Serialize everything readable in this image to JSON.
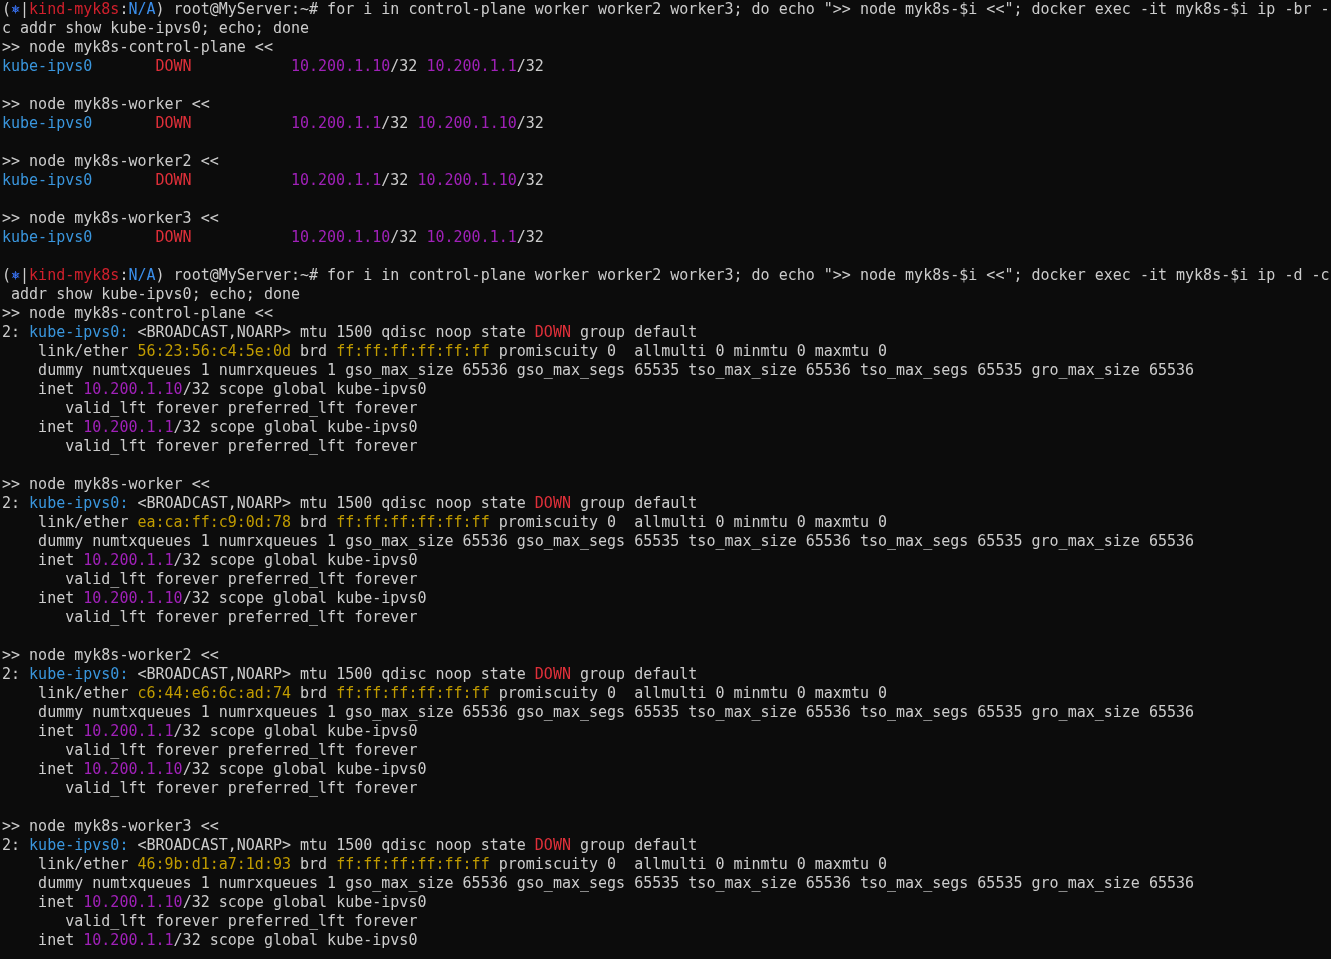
{
  "terminal": {
    "lines": [
      {
        "kind": "text",
        "segments": [
          {
            "kind": "plain",
            "text": "("
          },
          {
            "kind": "icon",
            "text": "⎈"
          },
          {
            "kind": "plain",
            "text": "|"
          },
          {
            "kind": "context",
            "text": "kind-myk8s"
          },
          {
            "kind": "plain",
            "text": ":"
          },
          {
            "kind": "namespace",
            "text": "N/A"
          },
          {
            "kind": "plain",
            "text": ") root@MyServer:~# for i in control-plane worker worker2 worker3; do echo \">> node myk8s-$i <<\"; docker exec -it myk8s-$i ip -br -"
          }
        ]
      },
      {
        "kind": "text",
        "segments": [
          {
            "kind": "plain",
            "text": "c addr show kube-ipvs0; echo; done"
          }
        ]
      },
      {
        "kind": "text",
        "segments": [
          {
            "kind": "plain",
            "text": ">> node myk8s-control-plane <<"
          }
        ]
      },
      {
        "kind": "brief",
        "iface": "kube-ipvs0",
        "state": "DOWN",
        "addresses": [
          {
            "ip": "10.200.1.10",
            "prefix": "/32"
          },
          {
            "ip": "10.200.1.1",
            "prefix": "/32"
          }
        ]
      },
      {
        "kind": "blank"
      },
      {
        "kind": "text",
        "segments": [
          {
            "kind": "plain",
            "text": ">> node myk8s-worker <<"
          }
        ]
      },
      {
        "kind": "brief",
        "iface": "kube-ipvs0",
        "state": "DOWN",
        "addresses": [
          {
            "ip": "10.200.1.1",
            "prefix": "/32"
          },
          {
            "ip": "10.200.1.10",
            "prefix": "/32"
          }
        ]
      },
      {
        "kind": "blank"
      },
      {
        "kind": "text",
        "segments": [
          {
            "kind": "plain",
            "text": ">> node myk8s-worker2 <<"
          }
        ]
      },
      {
        "kind": "brief",
        "iface": "kube-ipvs0",
        "state": "DOWN",
        "addresses": [
          {
            "ip": "10.200.1.1",
            "prefix": "/32"
          },
          {
            "ip": "10.200.1.10",
            "prefix": "/32"
          }
        ]
      },
      {
        "kind": "blank"
      },
      {
        "kind": "text",
        "segments": [
          {
            "kind": "plain",
            "text": ">> node myk8s-worker3 <<"
          }
        ]
      },
      {
        "kind": "brief",
        "iface": "kube-ipvs0",
        "state": "DOWN",
        "addresses": [
          {
            "ip": "10.200.1.10",
            "prefix": "/32"
          },
          {
            "ip": "10.200.1.1",
            "prefix": "/32"
          }
        ]
      },
      {
        "kind": "blank"
      },
      {
        "kind": "text",
        "segments": [
          {
            "kind": "plain",
            "text": "("
          },
          {
            "kind": "icon",
            "text": "⎈"
          },
          {
            "kind": "plain",
            "text": "|"
          },
          {
            "kind": "context",
            "text": "kind-myk8s"
          },
          {
            "kind": "plain",
            "text": ":"
          },
          {
            "kind": "namespace",
            "text": "N/A"
          },
          {
            "kind": "plain",
            "text": ") root@MyServer:~# for i in control-plane worker worker2 worker3; do echo \">> node myk8s-$i <<\"; docker exec -it myk8s-$i ip -d -c"
          }
        ]
      },
      {
        "kind": "text",
        "segments": [
          {
            "kind": "plain",
            "text": " addr show kube-ipvs0; echo; done"
          }
        ]
      },
      {
        "kind": "text",
        "segments": [
          {
            "kind": "plain",
            "text": ">> node myk8s-control-plane <<"
          }
        ]
      },
      {
        "kind": "text",
        "segments": [
          {
            "kind": "plain",
            "text": "2: "
          },
          {
            "kind": "iface",
            "text": "kube-ipvs0:"
          },
          {
            "kind": "plain",
            "text": " <BROADCAST,NOARP> mtu 1500 qdisc noop state "
          },
          {
            "kind": "state",
            "text": "DOWN"
          },
          {
            "kind": "plain",
            "text": " group default"
          }
        ]
      },
      {
        "kind": "text",
        "segments": [
          {
            "kind": "plain",
            "text": "    link/ether "
          },
          {
            "kind": "mac",
            "text": "56:23:56:c4:5e:0d"
          },
          {
            "kind": "plain",
            "text": " brd "
          },
          {
            "kind": "mac",
            "text": "ff:ff:ff:ff:ff:ff"
          },
          {
            "kind": "plain",
            "text": " promiscuity 0  allmulti 0 minmtu 0 maxmtu 0"
          }
        ]
      },
      {
        "kind": "text",
        "segments": [
          {
            "kind": "plain",
            "text": "    dummy numtxqueues 1 numrxqueues 1 gso_max_size 65536 gso_max_segs 65535 tso_max_size 65536 tso_max_segs 65535 gro_max_size 65536"
          }
        ]
      },
      {
        "kind": "text",
        "segments": [
          {
            "kind": "plain",
            "text": "    inet "
          },
          {
            "kind": "ip",
            "text": "10.200.1.10"
          },
          {
            "kind": "plain",
            "text": "/32 scope global kube-ipvs0"
          }
        ]
      },
      {
        "kind": "text",
        "segments": [
          {
            "kind": "plain",
            "text": "       valid_lft forever preferred_lft forever"
          }
        ]
      },
      {
        "kind": "text",
        "segments": [
          {
            "kind": "plain",
            "text": "    inet "
          },
          {
            "kind": "ip",
            "text": "10.200.1.1"
          },
          {
            "kind": "plain",
            "text": "/32 scope global kube-ipvs0"
          }
        ]
      },
      {
        "kind": "text",
        "segments": [
          {
            "kind": "plain",
            "text": "       valid_lft forever preferred_lft forever"
          }
        ]
      },
      {
        "kind": "blank"
      },
      {
        "kind": "text",
        "segments": [
          {
            "kind": "plain",
            "text": ">> node myk8s-worker <<"
          }
        ]
      },
      {
        "kind": "text",
        "segments": [
          {
            "kind": "plain",
            "text": "2: "
          },
          {
            "kind": "iface",
            "text": "kube-ipvs0:"
          },
          {
            "kind": "plain",
            "text": " <BROADCAST,NOARP> mtu 1500 qdisc noop state "
          },
          {
            "kind": "state",
            "text": "DOWN"
          },
          {
            "kind": "plain",
            "text": " group default"
          }
        ]
      },
      {
        "kind": "text",
        "segments": [
          {
            "kind": "plain",
            "text": "    link/ether "
          },
          {
            "kind": "mac",
            "text": "ea:ca:ff:c9:0d:78"
          },
          {
            "kind": "plain",
            "text": " brd "
          },
          {
            "kind": "mac",
            "text": "ff:ff:ff:ff:ff:ff"
          },
          {
            "kind": "plain",
            "text": " promiscuity 0  allmulti 0 minmtu 0 maxmtu 0"
          }
        ]
      },
      {
        "kind": "text",
        "segments": [
          {
            "kind": "plain",
            "text": "    dummy numtxqueues 1 numrxqueues 1 gso_max_size 65536 gso_max_segs 65535 tso_max_size 65536 tso_max_segs 65535 gro_max_size 65536"
          }
        ]
      },
      {
        "kind": "text",
        "segments": [
          {
            "kind": "plain",
            "text": "    inet "
          },
          {
            "kind": "ip",
            "text": "10.200.1.1"
          },
          {
            "kind": "plain",
            "text": "/32 scope global kube-ipvs0"
          }
        ]
      },
      {
        "kind": "text",
        "segments": [
          {
            "kind": "plain",
            "text": "       valid_lft forever preferred_lft forever"
          }
        ]
      },
      {
        "kind": "text",
        "segments": [
          {
            "kind": "plain",
            "text": "    inet "
          },
          {
            "kind": "ip",
            "text": "10.200.1.10"
          },
          {
            "kind": "plain",
            "text": "/32 scope global kube-ipvs0"
          }
        ]
      },
      {
        "kind": "text",
        "segments": [
          {
            "kind": "plain",
            "text": "       valid_lft forever preferred_lft forever"
          }
        ]
      },
      {
        "kind": "blank"
      },
      {
        "kind": "text",
        "segments": [
          {
            "kind": "plain",
            "text": ">> node myk8s-worker2 <<"
          }
        ]
      },
      {
        "kind": "text",
        "segments": [
          {
            "kind": "plain",
            "text": "2: "
          },
          {
            "kind": "iface",
            "text": "kube-ipvs0:"
          },
          {
            "kind": "plain",
            "text": " <BROADCAST,NOARP> mtu 1500 qdisc noop state "
          },
          {
            "kind": "state",
            "text": "DOWN"
          },
          {
            "kind": "plain",
            "text": " group default"
          }
        ]
      },
      {
        "kind": "text",
        "segments": [
          {
            "kind": "plain",
            "text": "    link/ether "
          },
          {
            "kind": "mac",
            "text": "c6:44:e6:6c:ad:74"
          },
          {
            "kind": "plain",
            "text": " brd "
          },
          {
            "kind": "mac",
            "text": "ff:ff:ff:ff:ff:ff"
          },
          {
            "kind": "plain",
            "text": " promiscuity 0  allmulti 0 minmtu 0 maxmtu 0"
          }
        ]
      },
      {
        "kind": "text",
        "segments": [
          {
            "kind": "plain",
            "text": "    dummy numtxqueues 1 numrxqueues 1 gso_max_size 65536 gso_max_segs 65535 tso_max_size 65536 tso_max_segs 65535 gro_max_size 65536"
          }
        ]
      },
      {
        "kind": "text",
        "segments": [
          {
            "kind": "plain",
            "text": "    inet "
          },
          {
            "kind": "ip",
            "text": "10.200.1.1"
          },
          {
            "kind": "plain",
            "text": "/32 scope global kube-ipvs0"
          }
        ]
      },
      {
        "kind": "text",
        "segments": [
          {
            "kind": "plain",
            "text": "       valid_lft forever preferred_lft forever"
          }
        ]
      },
      {
        "kind": "text",
        "segments": [
          {
            "kind": "plain",
            "text": "    inet "
          },
          {
            "kind": "ip",
            "text": "10.200.1.10"
          },
          {
            "kind": "plain",
            "text": "/32 scope global kube-ipvs0"
          }
        ]
      },
      {
        "kind": "text",
        "segments": [
          {
            "kind": "plain",
            "text": "       valid_lft forever preferred_lft forever"
          }
        ]
      },
      {
        "kind": "blank"
      },
      {
        "kind": "text",
        "segments": [
          {
            "kind": "plain",
            "text": ">> node myk8s-worker3 <<"
          }
        ]
      },
      {
        "kind": "text",
        "segments": [
          {
            "kind": "plain",
            "text": "2: "
          },
          {
            "kind": "iface",
            "text": "kube-ipvs0:"
          },
          {
            "kind": "plain",
            "text": " <BROADCAST,NOARP> mtu 1500 qdisc noop state "
          },
          {
            "kind": "state",
            "text": "DOWN"
          },
          {
            "kind": "plain",
            "text": " group default"
          }
        ]
      },
      {
        "kind": "text",
        "segments": [
          {
            "kind": "plain",
            "text": "    link/ether "
          },
          {
            "kind": "mac",
            "text": "46:9b:d1:a7:1d:93"
          },
          {
            "kind": "plain",
            "text": " brd "
          },
          {
            "kind": "mac",
            "text": "ff:ff:ff:ff:ff:ff"
          },
          {
            "kind": "plain",
            "text": " promiscuity 0  allmulti 0 minmtu 0 maxmtu 0"
          }
        ]
      },
      {
        "kind": "text",
        "segments": [
          {
            "kind": "plain",
            "text": "    dummy numtxqueues 1 numrxqueues 1 gso_max_size 65536 gso_max_segs 65535 tso_max_size 65536 tso_max_segs 65535 gro_max_size 65536"
          }
        ]
      },
      {
        "kind": "text",
        "segments": [
          {
            "kind": "plain",
            "text": "    inet "
          },
          {
            "kind": "ip",
            "text": "10.200.1.10"
          },
          {
            "kind": "plain",
            "text": "/32 scope global kube-ipvs0"
          }
        ]
      },
      {
        "kind": "text",
        "segments": [
          {
            "kind": "plain",
            "text": "       valid_lft forever preferred_lft forever"
          }
        ]
      },
      {
        "kind": "text",
        "segments": [
          {
            "kind": "plain",
            "text": "    inet "
          },
          {
            "kind": "ip",
            "text": "10.200.1.1"
          },
          {
            "kind": "plain",
            "text": "/32 scope global kube-ipvs0"
          }
        ]
      }
    ]
  }
}
